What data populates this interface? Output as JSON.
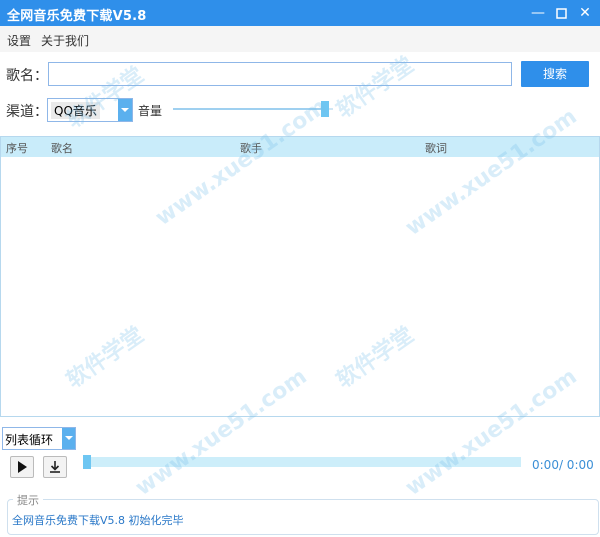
{
  "window": {
    "title": "全网音乐免费下载V5.8"
  },
  "menu": {
    "items": [
      "设置",
      "关于我们"
    ]
  },
  "search": {
    "label": "歌名：",
    "value": "",
    "button": "搜索"
  },
  "channel": {
    "label": "渠道：",
    "selected": "QQ音乐"
  },
  "volume": {
    "label": "音量",
    "level_percent": 95
  },
  "table": {
    "columns": [
      "序号",
      "歌名",
      "歌手",
      "歌词"
    ],
    "rows": []
  },
  "player": {
    "loop_mode": "列表循环",
    "time": "0:00/ 0:00",
    "progress_percent": 0
  },
  "tip": {
    "legend": "提示",
    "message": "全网音乐免费下载V5.8 初始化完毕"
  },
  "watermark": {
    "text1": "软件学堂",
    "text2": "www.xue51.com"
  },
  "colors": {
    "accent": "#2f8fea",
    "header": "#c9ecfa",
    "slider": "#6ec6f2"
  }
}
